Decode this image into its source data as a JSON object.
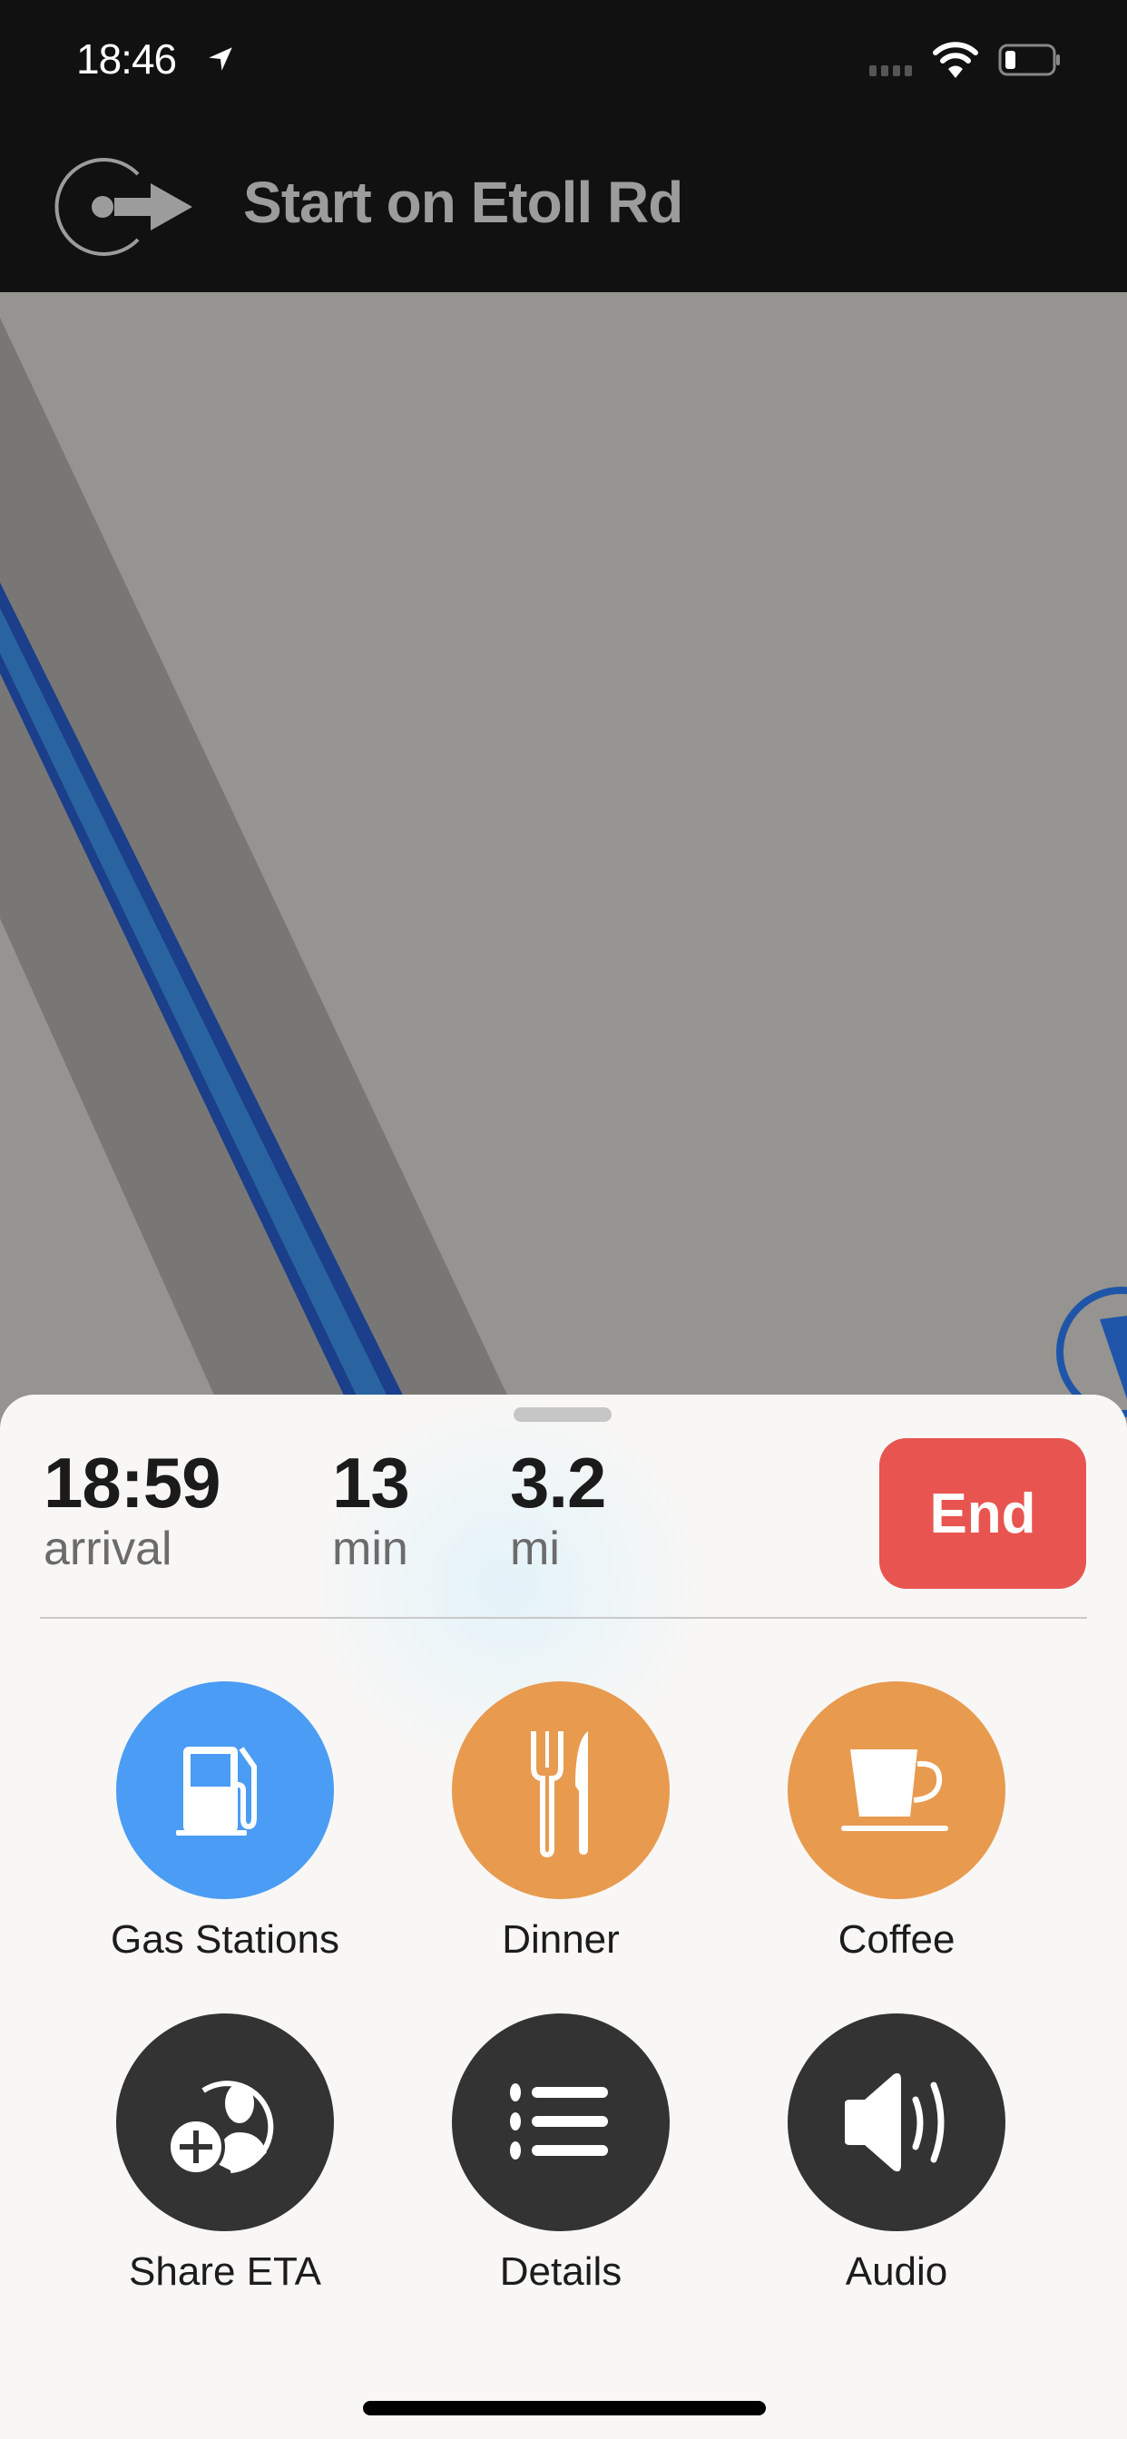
{
  "status_bar": {
    "time": "18:46",
    "location_icon": "location-arrow-icon",
    "signal_icon": "cellular-signal-icon",
    "wifi_icon": "wifi-icon",
    "battery_icon": "battery-icon"
  },
  "navigation": {
    "maneuver_icon": "start-route-icon",
    "instruction": "Start on Etoll Rd"
  },
  "map": {
    "route_color": "#2a64a0",
    "route_border_color": "#1b3f8a",
    "road_color": "#787776",
    "background_color": "#959490",
    "user_location_icon": "user-heading-icon"
  },
  "trip": {
    "arrival_value": "18:59",
    "arrival_label": "arrival",
    "duration_value": "13",
    "duration_label": "min",
    "distance_value": "3.2",
    "distance_label": "mi",
    "end_label": "End",
    "end_color": "#e85550"
  },
  "actions": [
    {
      "label": "Gas Stations",
      "icon": "gas-pump-icon",
      "color": "#4b9cf5"
    },
    {
      "label": "Dinner",
      "icon": "fork-knife-icon",
      "color": "#e89a4f"
    },
    {
      "label": "Coffee",
      "icon": "coffee-cup-icon",
      "color": "#e89a4f"
    },
    {
      "label": "Share ETA",
      "icon": "share-person-icon",
      "color": "#333333"
    },
    {
      "label": "Details",
      "icon": "list-icon",
      "color": "#333333"
    },
    {
      "label": "Audio",
      "icon": "speaker-icon",
      "color": "#333333"
    }
  ]
}
